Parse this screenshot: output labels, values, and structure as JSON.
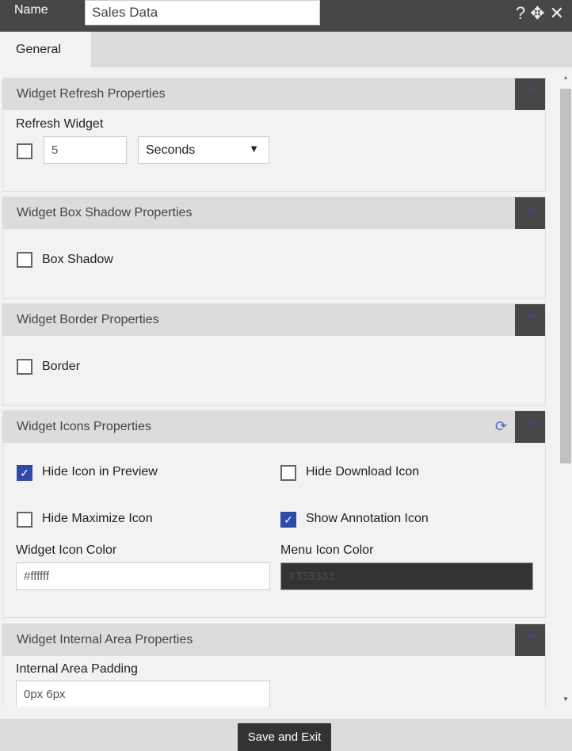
{
  "header": {
    "name_label": "Name",
    "name_value": "Sales Data",
    "help_icon": "?",
    "move_icon": "✥",
    "close_icon": "✕"
  },
  "tabs": [
    {
      "label": "General",
      "active": true
    }
  ],
  "sections": {
    "refresh": {
      "title": "Widget Refresh Properties",
      "field_label": "Refresh Widget",
      "checked": false,
      "value": "5",
      "unit": "Seconds"
    },
    "shadow": {
      "title": "Widget Box Shadow Properties",
      "checkbox_label": "Box Shadow",
      "checked": false
    },
    "border": {
      "title": "Widget Border Properties",
      "checkbox_label": "Border",
      "checked": false
    },
    "icons": {
      "title": "Widget Icons Properties",
      "hide_preview": {
        "label": "Hide Icon in Preview",
        "checked": true
      },
      "hide_download": {
        "label": "Hide Download Icon",
        "checked": false
      },
      "hide_maximize": {
        "label": "Hide Maximize Icon",
        "checked": false
      },
      "show_annotation": {
        "label": "Show Annotation Icon",
        "checked": true
      },
      "widget_icon_color_label": "Widget Icon Color",
      "widget_icon_color": "#ffffff",
      "menu_icon_color_label": "Menu Icon Color",
      "menu_icon_color": "#333333"
    },
    "internal": {
      "title": "Widget Internal Area Properties",
      "padding_label": "Internal Area Padding",
      "padding_value": "0px 6px"
    }
  },
  "footer": {
    "save_label": "Save and Exit"
  }
}
